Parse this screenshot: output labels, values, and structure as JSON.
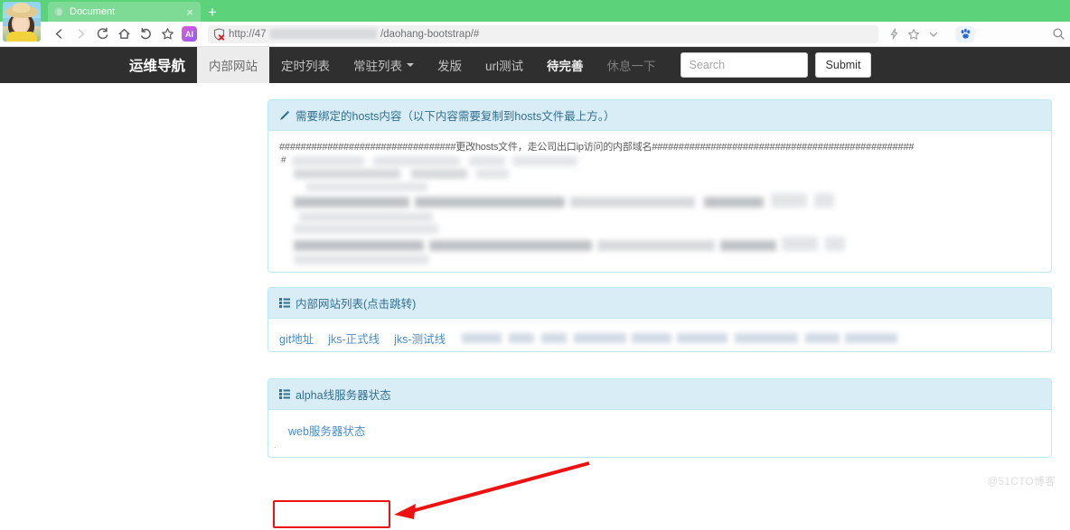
{
  "browser": {
    "tab": {
      "title": "Document",
      "favicon": "globe-icon",
      "close": "×"
    },
    "new_tab": "+",
    "toolbar": {
      "back": "back-icon",
      "forward": "forward-icon",
      "reload": "reload-icon",
      "home": "home-icon",
      "undo": "undo-icon",
      "bookmark": "star-icon",
      "ai_label": "AI",
      "url_prefix": "http://47",
      "url_suffix": "/daohang-bootstrap/#",
      "security": "shield-warning-icon",
      "lightning": "lightning-icon",
      "star": "star-icon",
      "chevron": "chevron-down-icon",
      "paw": "baidu-paw-icon",
      "search": "search-icon"
    }
  },
  "navbar": {
    "brand": "运维导航",
    "items": [
      {
        "label": "内部网站",
        "state": "active"
      },
      {
        "label": "定时列表",
        "state": "normal"
      },
      {
        "label": "常驻列表",
        "state": "dropdown"
      },
      {
        "label": "发版",
        "state": "normal"
      },
      {
        "label": "url测试",
        "state": "normal"
      },
      {
        "label": "待完善",
        "state": "normal"
      },
      {
        "label": "休息一下",
        "state": "disabled"
      }
    ],
    "search": {
      "placeholder": "Search",
      "value": ""
    },
    "submit_label": "Submit"
  },
  "panels": [
    {
      "icon": "pencil-icon",
      "title": "需要绑定的hosts内容（以下内容需要复制到hosts文件最上方。）",
      "hosts_line": "#################################更改hosts文件，走公司出口ip访问的内部域名#################################################",
      "hash_char": "#",
      "body_note": "blurred-hosts-entries"
    },
    {
      "icon": "list-icon",
      "title": "内部网站列表(点击跳转)",
      "links": [
        "git地址",
        "jks-正式线",
        "jks-测试线"
      ],
      "body_note": "blurred-links"
    },
    {
      "icon": "list-icon",
      "title": "alpha线服务器状态",
      "links": [
        "web服务器状态"
      ],
      "dot": "."
    }
  ],
  "annotations": {
    "highlight_box": "red-rectangle-around-web-server-status",
    "arrow": "red-arrow-pointing-left"
  },
  "watermark": "@51CTO博客",
  "colors": {
    "tabstrip_green": "#5cd37a",
    "navbar_dark": "#2f2f2f",
    "panel_heading_blue": "#d9edf7",
    "panel_border_blue": "#bce8f1",
    "panel_text_blue": "#31708f",
    "link_blue": "#4a8cc7",
    "annotation_red": "#ee1111"
  }
}
